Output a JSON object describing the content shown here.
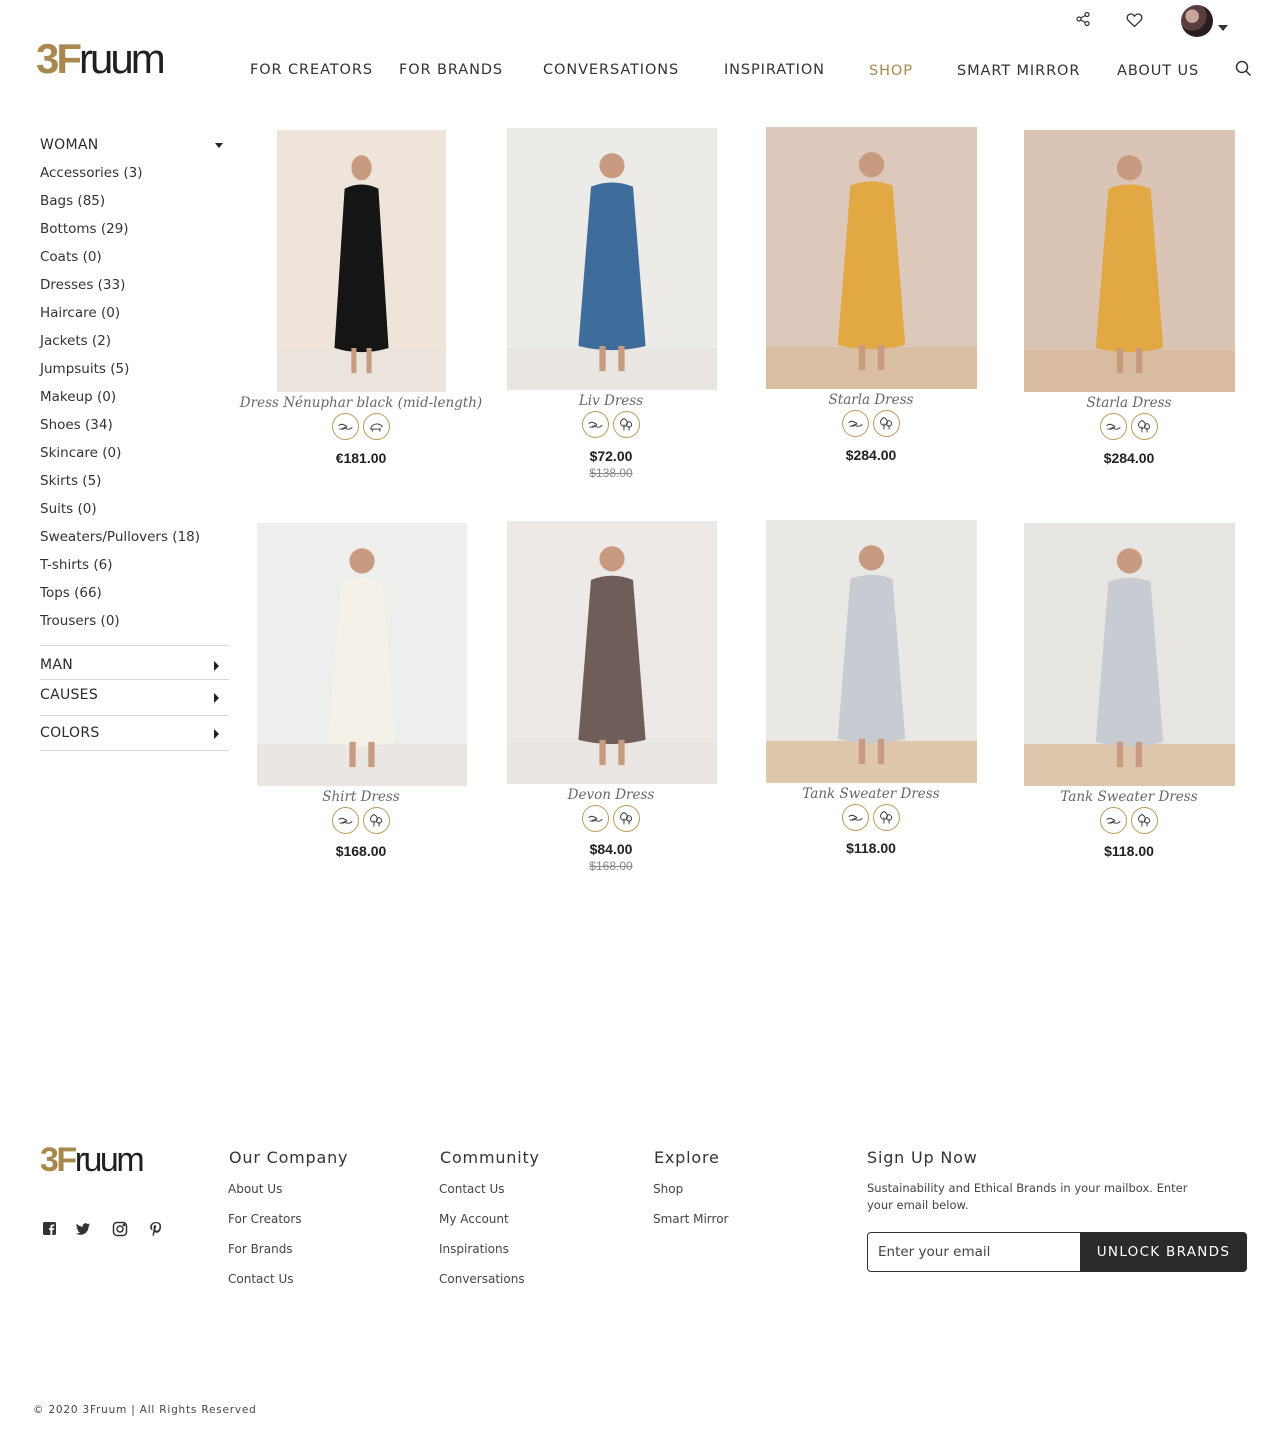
{
  "brand": {
    "logo_prefix": "3F",
    "logo_suffix": "ruum"
  },
  "nav": {
    "items": [
      {
        "label": "FOR CREATORS"
      },
      {
        "label": "FOR BRANDS"
      },
      {
        "label": "CONVERSATIONS"
      },
      {
        "label": "INSPIRATION"
      },
      {
        "label": "SHOP"
      },
      {
        "label": "SMART MIRROR"
      },
      {
        "label": "ABOUT US"
      }
    ],
    "active": "SHOP",
    "accent_color": "#a8884e"
  },
  "header_icons": [
    "share-icon",
    "heart-icon",
    "avatar",
    "search-icon"
  ],
  "sidebar": {
    "woman": {
      "label": "WOMAN",
      "items": [
        "Accessories (3)",
        "Bags (85)",
        "Bottoms (29)",
        "Coats (0)",
        "Dresses (33)",
        "Haircare (0)",
        "Jackets (2)",
        "Jumpsuits (5)",
        "Makeup (0)",
        "Shoes (34)",
        "Skincare (0)",
        "Skirts (5)",
        "Suits (0)",
        "Sweaters/Pullovers (18)",
        "T-shirts (6)",
        "Tops (66)",
        "Trousers (0)"
      ]
    },
    "sections": [
      {
        "label": "MAN"
      },
      {
        "label": "CAUSES"
      },
      {
        "label": "COLORS"
      }
    ]
  },
  "products": [
    {
      "name": "Dress Nénuphar black (mid-length)",
      "price": "€181.00",
      "old_price": "",
      "badges": [
        "fair-trade-icon",
        "vegan-icon"
      ]
    },
    {
      "name": "Liv Dress",
      "price": "$72.00",
      "old_price": "$138.00",
      "badges": [
        "fair-trade-icon",
        "eco-icon"
      ]
    },
    {
      "name": "Starla Dress",
      "price": "$284.00",
      "old_price": "",
      "badges": [
        "fair-trade-icon",
        "eco-icon"
      ]
    },
    {
      "name": "Starla Dress",
      "price": "$284.00",
      "old_price": "",
      "badges": [
        "fair-trade-icon",
        "eco-icon"
      ]
    },
    {
      "name": "Shirt Dress",
      "price": "$168.00",
      "old_price": "",
      "badges": [
        "fair-trade-icon",
        "eco-icon"
      ]
    },
    {
      "name": "Devon Dress",
      "price": "$84.00",
      "old_price": "$168.00",
      "badges": [
        "fair-trade-icon",
        "eco-icon"
      ]
    },
    {
      "name": "Tank Sweater Dress",
      "price": "$118.00",
      "old_price": "",
      "badges": [
        "fair-trade-icon",
        "eco-icon"
      ]
    },
    {
      "name": "Tank Sweater Dress",
      "price": "$118.00",
      "old_price": "",
      "badges": [
        "fair-trade-icon",
        "eco-icon"
      ]
    }
  ],
  "footer": {
    "columns": [
      {
        "title": "Our Company",
        "links": [
          "About Us",
          "For Creators",
          "For Brands",
          "Contact Us"
        ]
      },
      {
        "title": "Community",
        "links": [
          "Contact Us",
          "My Account",
          "Inspirations",
          "Conversations"
        ]
      },
      {
        "title": "Explore",
        "links": [
          "Shop",
          "Smart Mirror"
        ]
      }
    ],
    "signup": {
      "title": "Sign Up Now",
      "text": "Sustainability and Ethical Brands in your mailbox. Enter your email below.",
      "placeholder": "Enter your email",
      "button": "UNLOCK BRANDS"
    },
    "social": [
      "facebook-icon",
      "twitter-icon",
      "instagram-icon",
      "pinterest-icon"
    ],
    "copyright": "© 2020 3Fruum | All Rights Reserved"
  }
}
